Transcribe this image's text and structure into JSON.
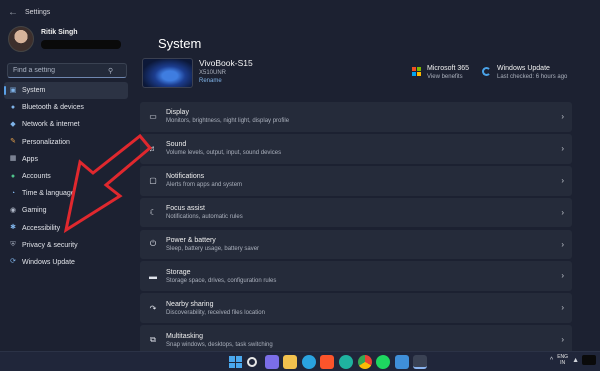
{
  "window": {
    "title": "Settings",
    "back_icon": "back-arrow-icon"
  },
  "profile": {
    "name": "Ritik Singh",
    "email_redacted": true
  },
  "search": {
    "placeholder": "Find a setting"
  },
  "sidebar": {
    "items": [
      {
        "label": "System",
        "icon": "monitor-icon",
        "active": true
      },
      {
        "label": "Bluetooth & devices",
        "icon": "bluetooth-icon"
      },
      {
        "label": "Network & internet",
        "icon": "wifi-icon"
      },
      {
        "label": "Personalization",
        "icon": "brush-icon"
      },
      {
        "label": "Apps",
        "icon": "apps-icon"
      },
      {
        "label": "Accounts",
        "icon": "person-icon"
      },
      {
        "label": "Time & language",
        "icon": "globe-clock-icon"
      },
      {
        "label": "Gaming",
        "icon": "gamepad-icon"
      },
      {
        "label": "Accessibility",
        "icon": "accessibility-icon"
      },
      {
        "label": "Privacy & security",
        "icon": "shield-icon"
      },
      {
        "label": "Windows Update",
        "icon": "update-icon"
      }
    ]
  },
  "main": {
    "title": "System",
    "device": {
      "name": "VivoBook-S15",
      "model": "X510UNR",
      "rename_label": "Rename"
    },
    "quick": [
      {
        "title": "Microsoft 365",
        "subtitle": "View benefits",
        "icon": "microsoft-icon"
      },
      {
        "title": "Windows Update",
        "subtitle": "Last checked: 6 hours ago",
        "icon": "windows-update-icon"
      }
    ],
    "cards": [
      {
        "title": "Display",
        "subtitle": "Monitors, brightness, night light, display profile",
        "icon": "display-icon"
      },
      {
        "title": "Sound",
        "subtitle": "Volume levels, output, input, sound devices",
        "icon": "speaker-icon"
      },
      {
        "title": "Notifications",
        "subtitle": "Alerts from apps and system",
        "icon": "notification-icon"
      },
      {
        "title": "Focus assist",
        "subtitle": "Notifications, automatic rules",
        "icon": "moon-icon"
      },
      {
        "title": "Power & battery",
        "subtitle": "Sleep, battery usage, battery saver",
        "icon": "power-icon"
      },
      {
        "title": "Storage",
        "subtitle": "Storage space, drives, configuration rules",
        "icon": "storage-icon"
      },
      {
        "title": "Nearby sharing",
        "subtitle": "Discoverability, received files location",
        "icon": "share-icon"
      },
      {
        "title": "Multitasking",
        "subtitle": "Snap windows, desktops, task switching",
        "icon": "multitasking-icon"
      }
    ]
  },
  "annotation": {
    "type": "red-outlined-arrow",
    "color": "#e0282e",
    "points_to": "Accessibility"
  },
  "taskbar": {
    "icons": [
      "windows-start-icon",
      "search-icon",
      "chat-icon",
      "file-explorer-icon",
      "telegram-icon",
      "brave-icon",
      "edge-icon",
      "chrome-icon",
      "spotify-icon",
      "photos-icon",
      "settings-icon"
    ],
    "tray": {
      "caret": "^",
      "lang_line1": "ENG",
      "lang_line2": "IN"
    }
  },
  "colors": {
    "background": "#1c2131",
    "card": "#252b3a",
    "accent": "#5aa0e6",
    "arrow": "#e0282e"
  }
}
